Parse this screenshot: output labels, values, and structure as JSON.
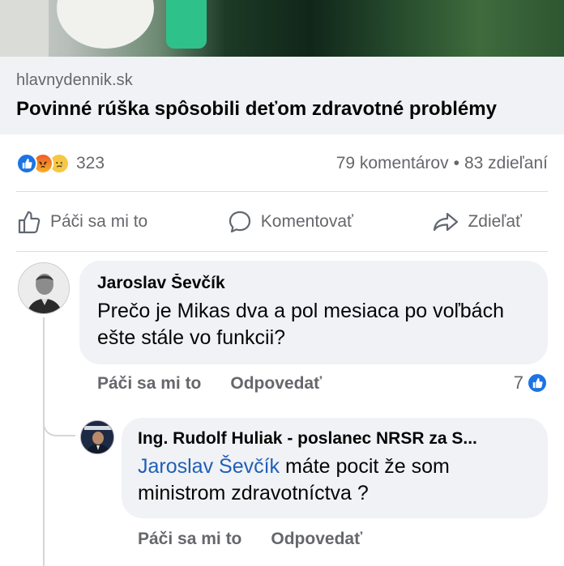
{
  "link": {
    "domain": "hlavnydennik.sk",
    "title": "Povinné rúška spôsobili deťom zdravotné problémy"
  },
  "stats": {
    "reactions": [
      "like-icon",
      "angry-icon",
      "sad-icon"
    ],
    "reaction_count": "323",
    "comments": "79 komentárov",
    "separator": "•",
    "shares": "83 zdieľaní"
  },
  "actions": {
    "like": "Páči sa mi to",
    "comment": "Komentovať",
    "share": "Zdieľať"
  },
  "comments": [
    {
      "author": "Jaroslav Ševčík",
      "text": "Prečo je Mikas dva a pol mesiaca po voľbách ešte stále vo funkcii?",
      "like_label": "Páči sa mi to",
      "reply_label": "Odpovedať",
      "like_count": "7"
    },
    {
      "author": "Ing. Rudolf Huliak - poslanec NRSR za S...",
      "mention": "Jaroslav Ševčík",
      "text": " máte pocit že som ministrom zdravotníctva ?",
      "like_label": "Páči sa mi to",
      "reply_label": "Odpovedať"
    }
  ],
  "colors": {
    "accent": "#1b74e4",
    "mention": "#1f5fb8",
    "secondary_text": "#65676b",
    "bubble": "#f0f2f5"
  }
}
